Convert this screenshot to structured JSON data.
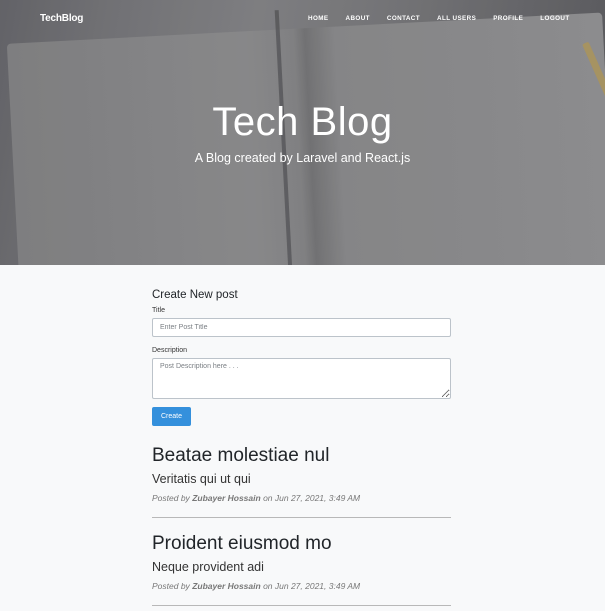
{
  "nav": {
    "brand": "TechBlog",
    "links": [
      "HOME",
      "ABOUT",
      "CONTACT",
      "ALL USERS",
      "PROFILE",
      "LOGOUT"
    ]
  },
  "hero": {
    "title": "Tech Blog",
    "subtitle": "A Blog created by Laravel and React.js"
  },
  "form": {
    "heading": "Create New post",
    "title_label": "Title",
    "title_placeholder": "Enter Post Title",
    "title_value": "",
    "description_label": "Description",
    "description_placeholder": "Post Description here . . .",
    "description_value": "",
    "submit_label": "Create"
  },
  "posts": [
    {
      "title": "Beatae molestiae nul",
      "description": "Veritatis qui ut qui",
      "posted_by_prefix": "Posted by",
      "author": "Zubayer Hossain",
      "date_text": "on Jun 27, 2021, 3:49 AM"
    },
    {
      "title": "Proident eiusmod mo",
      "description": "Neque provident adi",
      "posted_by_prefix": "Posted by",
      "author": "Zubayer Hossain",
      "date_text": "on Jun 27, 2021, 3:49 AM"
    }
  ],
  "colors": {
    "primary_button": "#3490dc",
    "page_background": "#f8f9fa"
  }
}
